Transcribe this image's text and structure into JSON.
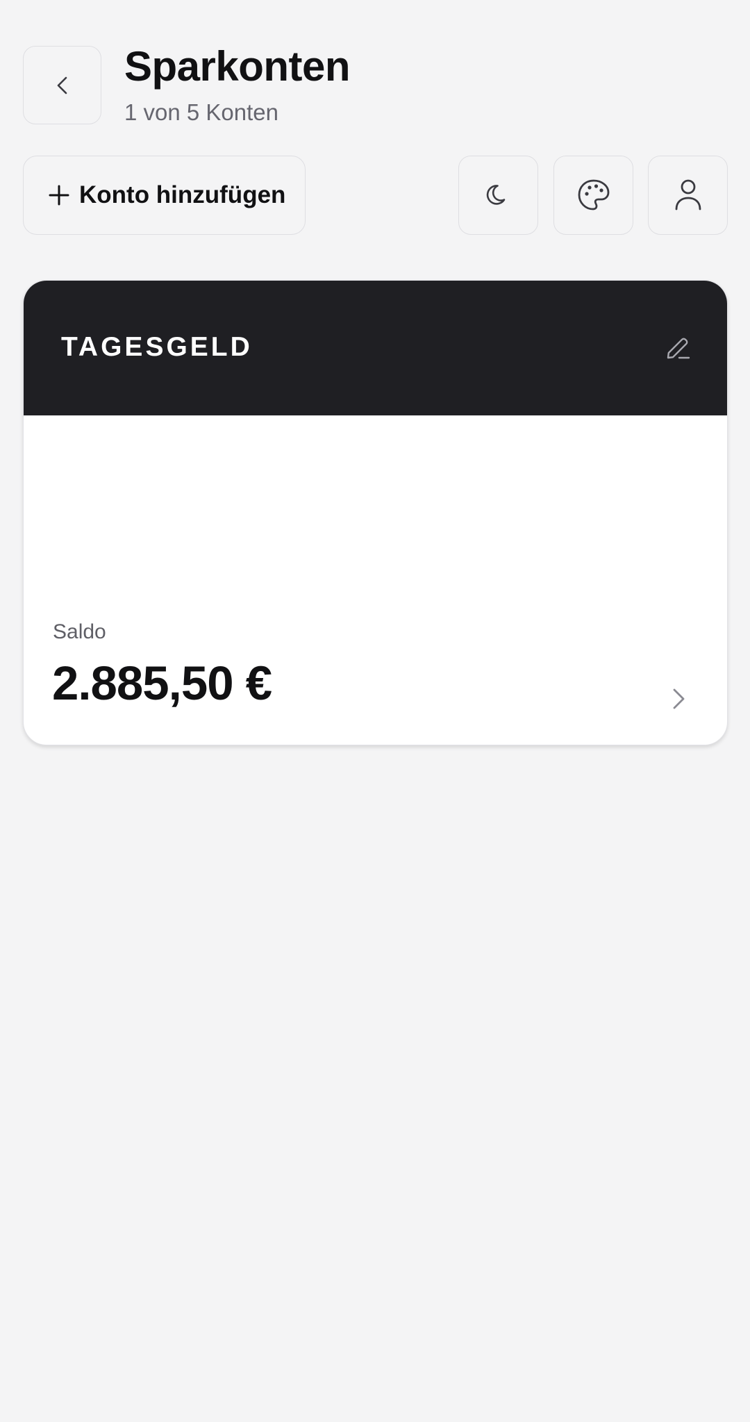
{
  "header": {
    "title": "Sparkonten",
    "subtitle": "1 von 5 Konten",
    "back_icon": "chevron-left-icon"
  },
  "toolbar": {
    "add_account_label": "Konto hinzufügen",
    "add_icon": "plus-icon",
    "theme_icon": "moon-icon",
    "palette_icon": "palette-icon",
    "profile_icon": "user-icon"
  },
  "account_card": {
    "name": "TAGESGELD",
    "balance_label": "Saldo",
    "balance_value": "2.885,50 €",
    "edit_icon": "pencil-icon",
    "open_icon": "chevron-right-icon"
  },
  "colors": {
    "background": "#f4f4f5",
    "card_header": "#1f1f23",
    "card_body": "#ffffff",
    "text_primary": "#111113",
    "text_secondary": "#66666f",
    "border": "#dedee2"
  }
}
